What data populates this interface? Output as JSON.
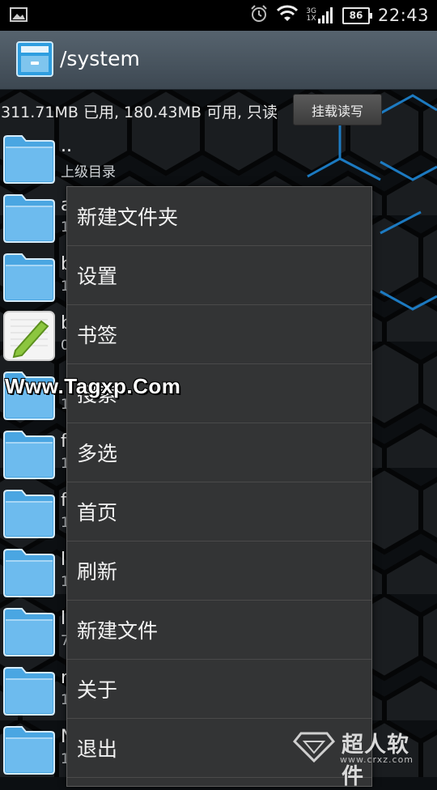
{
  "status_bar": {
    "time": "22:43",
    "battery": "86",
    "network_top": "3G",
    "network_bottom": "1X",
    "icons": [
      "image-notification-icon",
      "alarm-icon",
      "wifi-icon",
      "signal-icon",
      "battery-icon"
    ]
  },
  "app_bar": {
    "title": "/system"
  },
  "storage": {
    "info": "311.71MB 已用, 180.43MB 可用, 只读",
    "mount_button": "挂载读写"
  },
  "files": [
    {
      "name": "..",
      "sub": "上级目录",
      "type": "folder"
    },
    {
      "name": "a",
      "sub": "1",
      "type": "folder"
    },
    {
      "name": "b",
      "sub": "1",
      "type": "folder"
    },
    {
      "name": "b",
      "sub": "0",
      "type": "file"
    },
    {
      "name": "",
      "sub": "1",
      "type": "folder"
    },
    {
      "name": "f",
      "sub": "1",
      "type": "folder"
    },
    {
      "name": "f",
      "sub": "1",
      "type": "folder"
    },
    {
      "name": "l",
      "sub": "1",
      "type": "folder"
    },
    {
      "name": "l",
      "sub": "7",
      "type": "folder"
    },
    {
      "name": "n",
      "sub": "1",
      "type": "folder"
    },
    {
      "name": "N",
      "sub": "1",
      "type": "folder"
    }
  ],
  "menu": {
    "items": [
      "新建文件夹",
      "设置",
      "书签",
      "搜索",
      "多选",
      "首页",
      "刷新",
      "新建文件",
      "关于",
      "退出"
    ]
  },
  "watermarks": {
    "left": "Www.Tagxp.Com",
    "brand": "超人软件",
    "url": "www.crxz.com"
  },
  "colors": {
    "accent_hex": "#2a8fd6",
    "menu_bg": "#333435"
  }
}
